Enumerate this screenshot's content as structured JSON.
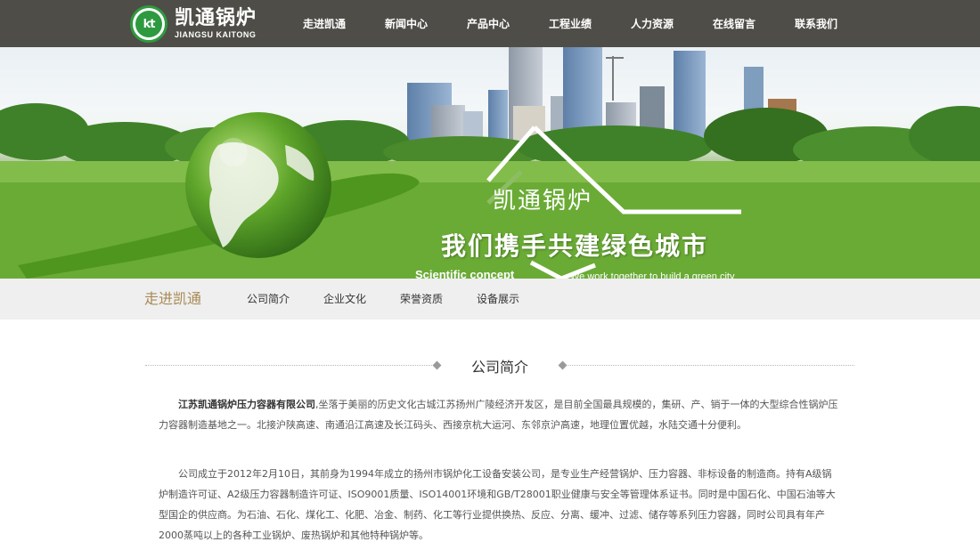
{
  "header": {
    "logo_mark": "kt",
    "logo_cn": "凯通锅炉",
    "logo_en": "JIANGSU KAITONG",
    "nav": [
      "走进凯通",
      "新闻中心",
      "产品中心",
      "工程业绩",
      "人力资源",
      "在线留言",
      "联系我们"
    ]
  },
  "banner": {
    "title": "凯通锅炉",
    "slogan": "我们携手共建绿色城市",
    "en_left": "Scientific concept",
    "en_right": "We work together to build a green city"
  },
  "subnav": {
    "title": "走进凯通",
    "items": [
      "公司简介",
      "企业文化",
      "荣誉资质",
      "设备展示"
    ]
  },
  "section": {
    "title": "公司简介"
  },
  "content": {
    "p1_company": "江苏凯通锅炉压力容器有限公司",
    "p1_text": ",坐落于美丽的历史文化古城江苏扬州广陵经济开发区，是目前全国最具规模的，集研、产、销于一体的大型综合性锅炉压力容器制造基地之一。北接沪陕高速、南通沿江高速及长江码头、西接京杭大运河、东邻京沪高速，地理位置优越，水陆交通十分便利。",
    "p2_text": "公司成立于2012年2月10日，其前身为1994年成立的扬州市锅炉化工设备安装公司，是专业生产经营锅炉、压力容器、非标设备的制造商。持有A级锅炉制造许可证、A2级压力容器制造许可证、ISO9001质量、ISO14001环境和GB/T28001职业健康与安全等管理体系证书。同时是中国石化、中国石油等大型国企的供应商。为石油、石化、煤化工、化肥、冶金、制药、化工等行业提供换热、反应、分离、缓冲、过滤、储存等系列压力容器，同时公司具有年产2000蒸吨以上的各种工业锅炉、废热锅炉和其他特种锅炉等。"
  },
  "colors": {
    "header_bg": "#4f4d47",
    "logo_green": "#2e9a3f",
    "subnav_bg": "#efefef",
    "subnav_title": "#a88a55"
  }
}
